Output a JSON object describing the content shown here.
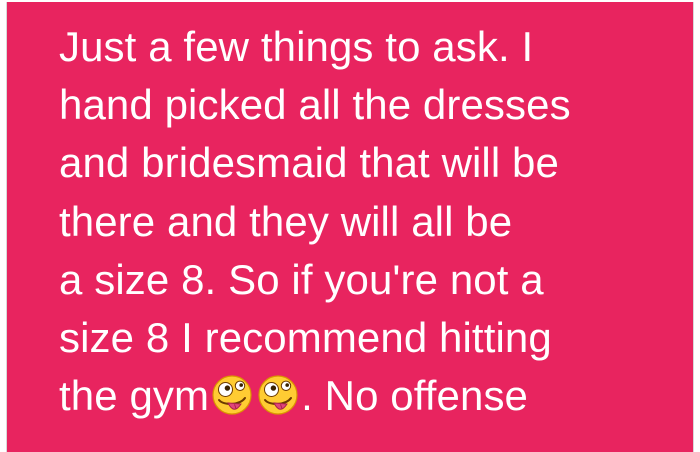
{
  "message": {
    "lines": [
      "Just a few things to ask. I",
      "hand picked all the dresses",
      "and bridesmaid that will be",
      "there and they will all be",
      "a size 8. So if you're not a",
      "size 8 I recommend hitting"
    ],
    "last_line_prefix": "the gym",
    "last_line_suffix": ". No offense"
  },
  "emoji": {
    "name": "zany-face-icon",
    "count": 2
  },
  "colors": {
    "bubble_background": "#e8245f",
    "text": "#ffffff",
    "emoji_face": "#ffcc33",
    "emoji_tongue": "#e0457b"
  }
}
